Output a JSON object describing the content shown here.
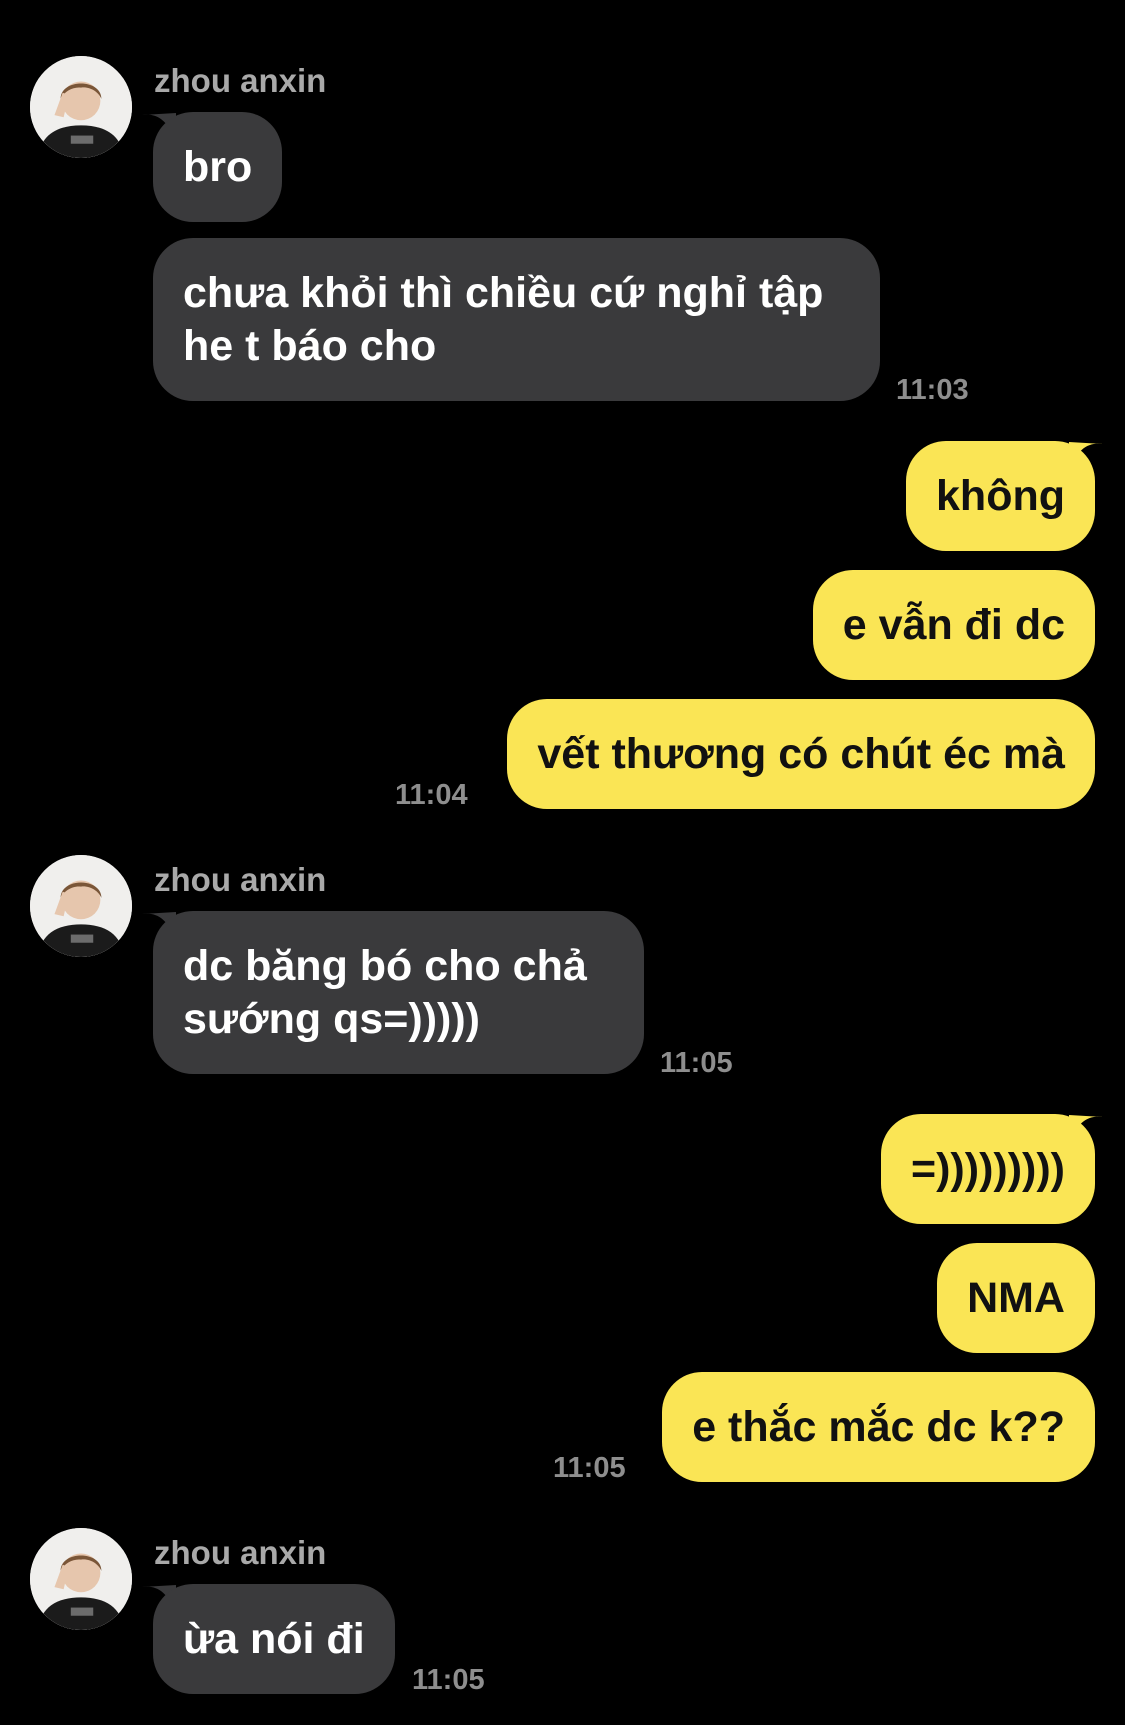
{
  "colors": {
    "background": "#000000",
    "incoming_bubble": "#3a3a3c",
    "outgoing_bubble": "#fae555",
    "sender_name": "#a9a9a9",
    "timestamp": "#8e8e8e"
  },
  "chat": {
    "group1": {
      "sender": "zhou anxin",
      "avatar_icon": "profile-photo-icon",
      "messages": [
        "bro",
        "chưa khỏi thì chiều cứ nghỉ tập\nhe t báo cho"
      ],
      "time": "11:03"
    },
    "group2": {
      "messages": [
        "không",
        "e vẫn đi dc",
        "vết thương có chút éc mà"
      ],
      "time": "11:04"
    },
    "group3": {
      "sender": "zhou anxin",
      "avatar_icon": "profile-photo-icon",
      "messages": [
        "dc băng bó cho chả\nsướng qs=)))))"
      ],
      "time": "11:05"
    },
    "group4": {
      "messages": [
        "=)))))))))",
        "NMA",
        "e thắc mắc dc k??"
      ],
      "time": "11:05"
    },
    "group5": {
      "sender": "zhou anxin",
      "avatar_icon": "profile-photo-icon",
      "messages": [
        "ừa nói đi"
      ],
      "time": "11:05"
    }
  }
}
